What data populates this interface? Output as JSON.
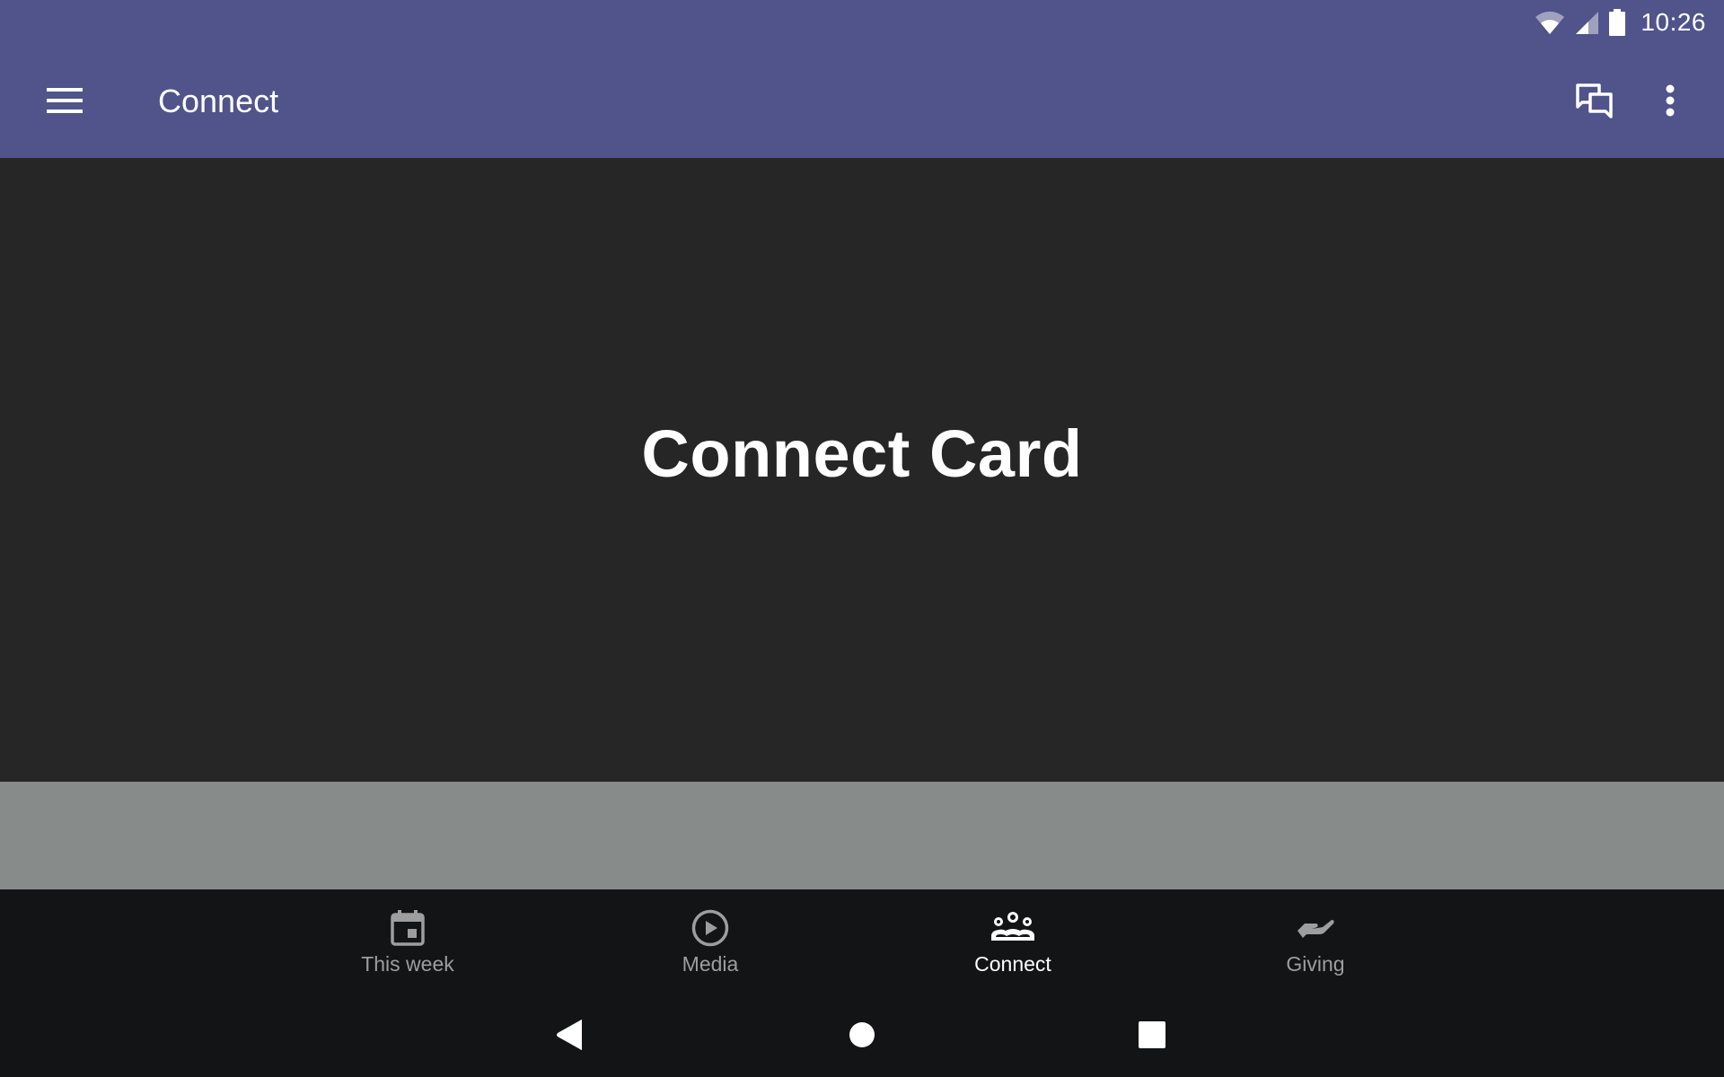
{
  "status_bar": {
    "time": "10:26",
    "icons": [
      "wifi-icon",
      "cellular-signal-icon",
      "battery-icon"
    ]
  },
  "app_bar": {
    "title": "Connect",
    "menu_icon": "hamburger-menu-icon",
    "actions": [
      {
        "icon": "chat-bubbles-icon",
        "label": "Messages"
      },
      {
        "icon": "more-vert-icon",
        "label": "More options"
      }
    ],
    "color": "#50548a"
  },
  "content": {
    "title": "Connect Card",
    "background": "#262626"
  },
  "bottom_nav": {
    "items": [
      {
        "label": "This week",
        "icon": "calendar-icon",
        "active": false
      },
      {
        "label": "Media",
        "icon": "play-circle-icon",
        "active": false
      },
      {
        "label": "Connect",
        "icon": "groups-icon",
        "active": true
      },
      {
        "label": "Giving",
        "icon": "giving-hand-icon",
        "active": false
      }
    ]
  },
  "system_nav": {
    "buttons": [
      {
        "name": "back",
        "icon": "back-triangle-icon"
      },
      {
        "name": "home",
        "icon": "home-circle-icon"
      },
      {
        "name": "recents",
        "icon": "recents-square-icon"
      }
    ]
  }
}
